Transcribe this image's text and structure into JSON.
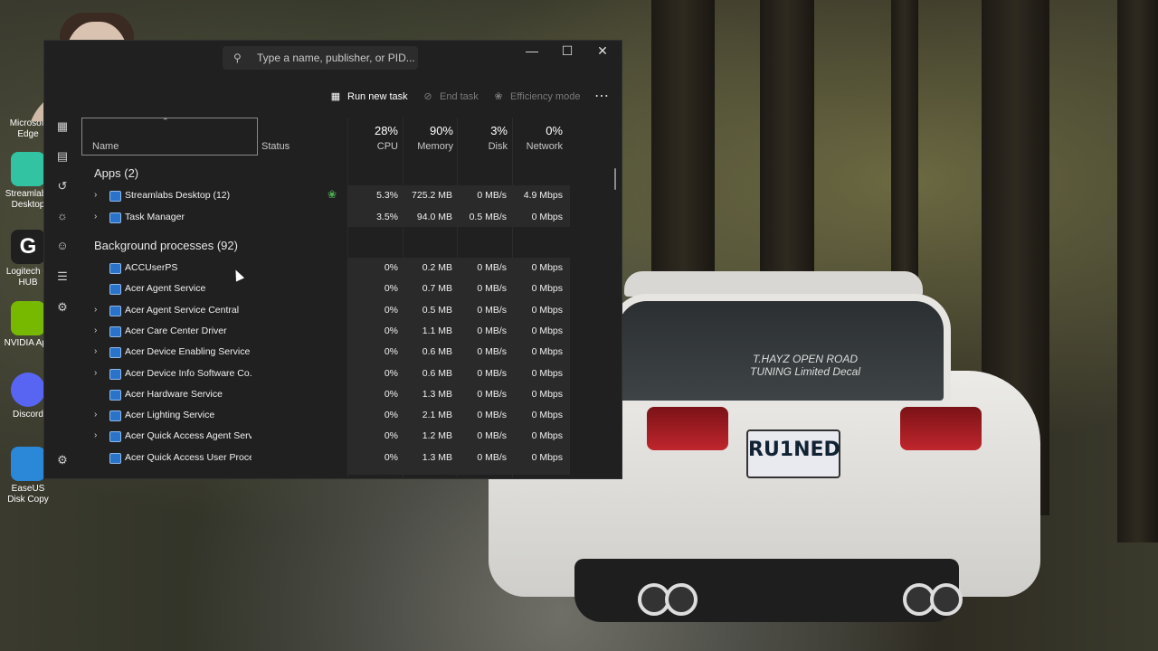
{
  "desktop": {
    "icons": [
      {
        "label": "Microsoft Edge",
        "color": "#1b6ed1"
      },
      {
        "label": "Streamlabs Desktop",
        "color": "#31c3a2"
      },
      {
        "label": "Logitech G HUB",
        "color": "#1f1f1f"
      },
      {
        "label": "NVIDIA App",
        "color": "#76b900"
      },
      {
        "label": "Discord",
        "color": "#5865f2"
      },
      {
        "label": "EaseUS Disk Copy",
        "color": "#2b87d8"
      }
    ],
    "plate_text": "RU1NED",
    "decal_text": "T.HAYZ OPEN ROAD TUNING Limited Decal"
  },
  "task_manager": {
    "search_placeholder": "Type a name, publisher, or PID...",
    "window_buttons": {
      "minimize": "—",
      "maximize": "☐",
      "close": "✕"
    },
    "toolbar": {
      "run_new_task": "Run new task",
      "end_task": "End task",
      "efficiency_mode": "Efficiency mode",
      "more": "⋯"
    },
    "columns": {
      "name": "Name",
      "status": "Status",
      "cpu": {
        "pct": "28%",
        "label": "CPU"
      },
      "memory": {
        "pct": "90%",
        "label": "Memory"
      },
      "disk": {
        "pct": "3%",
        "label": "Disk"
      },
      "network": {
        "pct": "0%",
        "label": "Network"
      }
    },
    "apps_group": "Apps (2)",
    "apps": [
      {
        "name": "Streamlabs Desktop (12)",
        "cpu": "5.3%",
        "mem": "725.2 MB",
        "disk": "0 MB/s",
        "net": "4.9 Mbps",
        "expandable": true,
        "efficiency": true
      },
      {
        "name": "Task Manager",
        "cpu": "3.5%",
        "mem": "94.0 MB",
        "disk": "0.5 MB/s",
        "net": "0 Mbps",
        "expandable": true
      }
    ],
    "bg_group": "Background processes (92)",
    "processes": [
      {
        "name": "ACCUserPS",
        "cpu": "0%",
        "mem": "0.2 MB",
        "disk": "0 MB/s",
        "net": "0 Mbps",
        "expandable": false
      },
      {
        "name": "Acer Agent Service",
        "cpu": "0%",
        "mem": "0.7 MB",
        "disk": "0 MB/s",
        "net": "0 Mbps",
        "expandable": false
      },
      {
        "name": "Acer Agent Service Central",
        "cpu": "0%",
        "mem": "0.5 MB",
        "disk": "0 MB/s",
        "net": "0 Mbps",
        "expandable": true
      },
      {
        "name": "Acer Care Center Driver",
        "cpu": "0%",
        "mem": "1.1 MB",
        "disk": "0 MB/s",
        "net": "0 Mbps",
        "expandable": true
      },
      {
        "name": "Acer Device Enabling Service ...",
        "cpu": "0%",
        "mem": "0.6 MB",
        "disk": "0 MB/s",
        "net": "0 Mbps",
        "expandable": true
      },
      {
        "name": "Acer Device Info Software Co...",
        "cpu": "0%",
        "mem": "0.6 MB",
        "disk": "0 MB/s",
        "net": "0 Mbps",
        "expandable": true
      },
      {
        "name": "Acer Hardware Service",
        "cpu": "0%",
        "mem": "1.3 MB",
        "disk": "0 MB/s",
        "net": "0 Mbps",
        "expandable": false
      },
      {
        "name": "Acer Lighting Service",
        "cpu": "0%",
        "mem": "2.1 MB",
        "disk": "0 MB/s",
        "net": "0 Mbps",
        "expandable": true
      },
      {
        "name": "Acer Quick Access Agent Servi...",
        "cpu": "0%",
        "mem": "1.2 MB",
        "disk": "0 MB/s",
        "net": "0 Mbps",
        "expandable": true
      },
      {
        "name": "Acer Quick Access User Process",
        "cpu": "0%",
        "mem": "1.3 MB",
        "disk": "0 MB/s",
        "net": "0 Mbps",
        "expandable": false
      }
    ],
    "sidebar_icons": [
      "processes-icon",
      "performance-icon",
      "app-history-icon",
      "startup-apps-icon",
      "users-icon",
      "details-icon",
      "services-icon",
      "settings-icon"
    ]
  }
}
